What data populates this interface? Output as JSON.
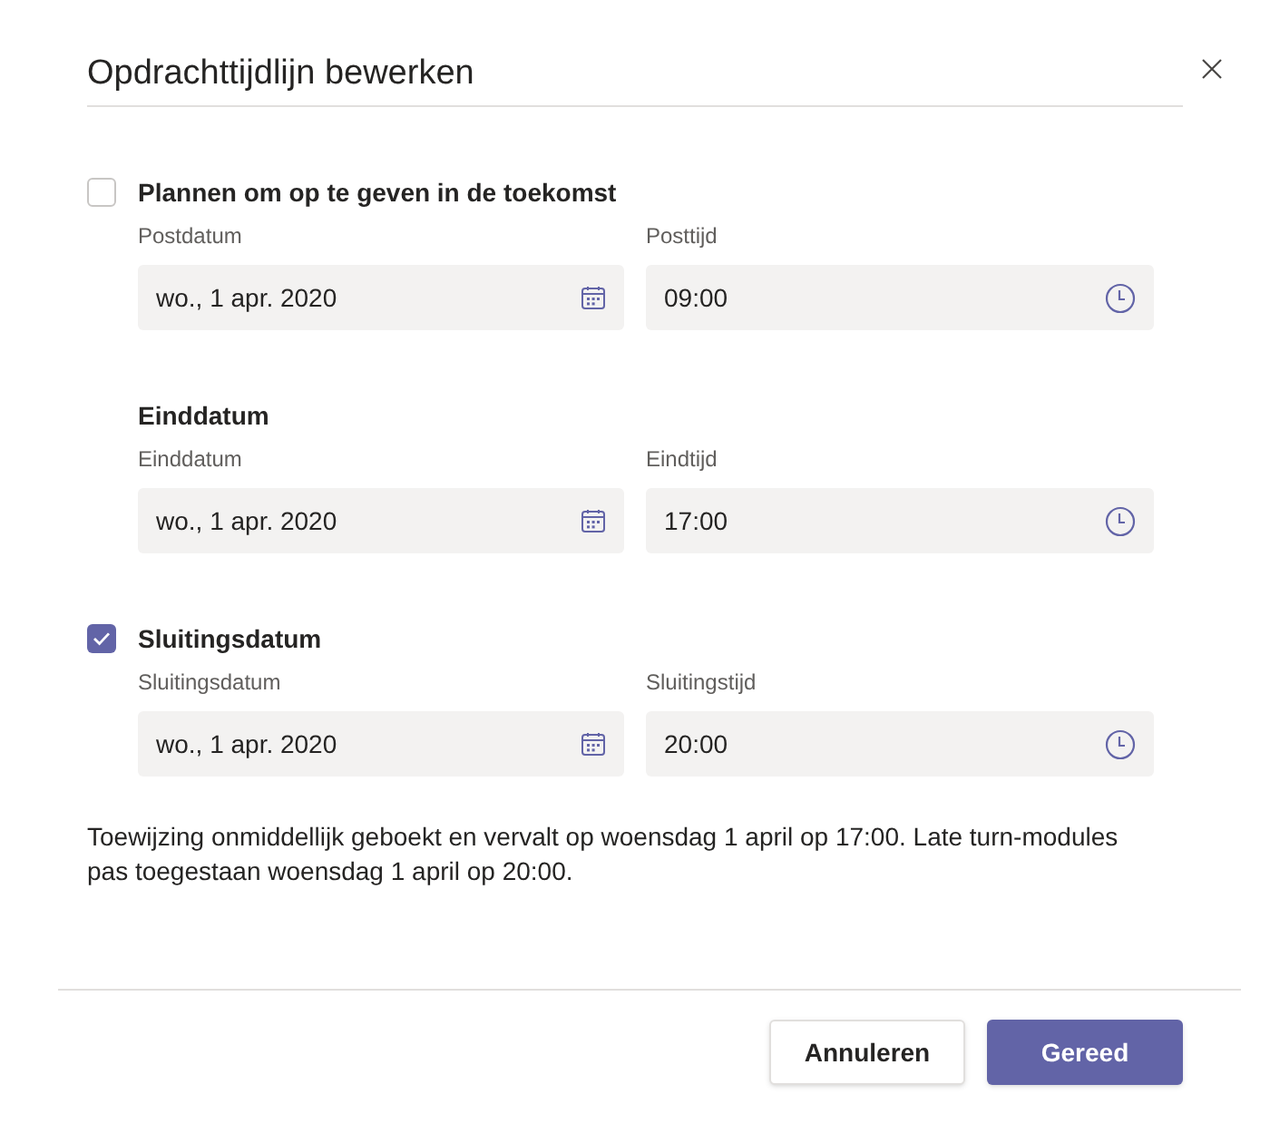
{
  "dialog": {
    "title": "Opdrachttijdlijn bewerken"
  },
  "sections": [
    {
      "kind": "checkbox",
      "label": "Plannen om op te geven in de toekomst",
      "checked": false,
      "date_label": "Postdatum",
      "date_value": "wo., 1 apr. 2020",
      "time_label": "Posttijd",
      "time_value": "09:00"
    },
    {
      "kind": "heading",
      "label": "Einddatum",
      "date_label": "Einddatum",
      "date_value": "wo., 1 apr. 2020",
      "time_label": "Eindtijd",
      "time_value": "17:00"
    },
    {
      "kind": "checkbox",
      "label": "Sluitingsdatum",
      "checked": true,
      "date_label": "Sluitingsdatum",
      "date_value": "wo., 1 apr. 2020",
      "time_label": "Sluitingstijd",
      "time_value": "20:00"
    }
  ],
  "summary": "Toewijzing onmiddellijk geboekt en vervalt op woensdag 1 april op 17:00. Late turn-modules pas toegestaan woensdag 1 april op 20:00.",
  "buttons": [
    {
      "kind": "secondary",
      "label": "Annuleren"
    },
    {
      "kind": "primary",
      "label": "Gereed"
    }
  ]
}
